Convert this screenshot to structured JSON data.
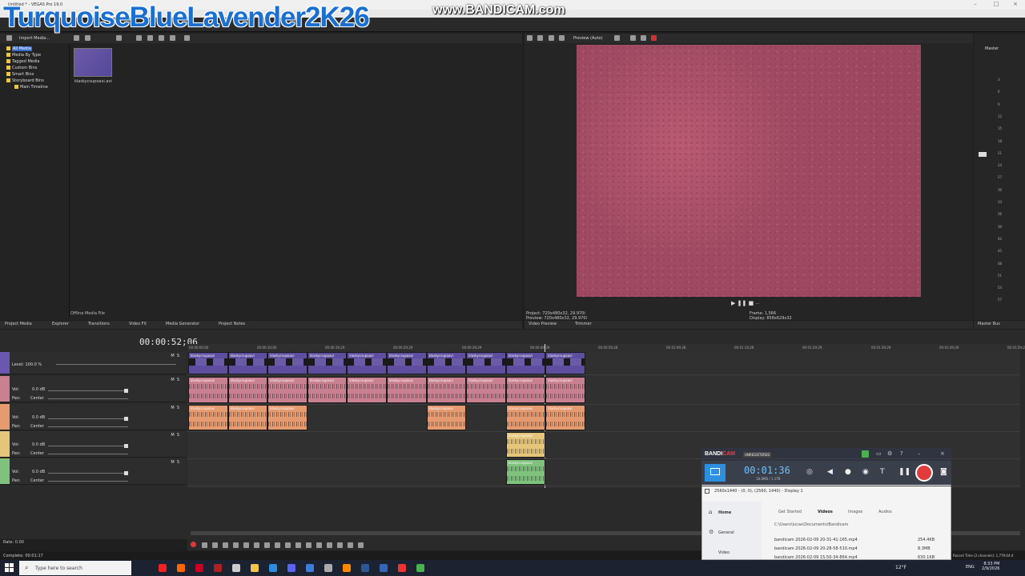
{
  "window": {
    "title": "Untitled * - VEGAS Pro 19.0",
    "overlay_title": "TurquoiseBlueLavender2K26",
    "watermark": "www.BANDICAM.com"
  },
  "media_pane": {
    "import_label": "Import Media...",
    "tree": [
      "All Media",
      "Media By Type",
      "Tagged Media",
      "Custom Bins",
      "Smart Bins",
      "Storyboard Bins",
      "Main Timeline"
    ],
    "thumbnail_label": "klaskycsupoavi.avi",
    "offline_label": "Offline Media File"
  },
  "bottom_tabs": [
    "Project Media",
    "Explorer",
    "Transitions",
    "Video FX",
    "Media Generator",
    "Project Notes"
  ],
  "preview": {
    "label": "Preview (Auto)",
    "project": "Project:  720x480x32, 29.970i",
    "preview_res": "Preview: 720x480x32, 29.970i",
    "frame": "Frame:     1,566",
    "display": "Display:    858x629x32",
    "tabs": [
      "Video Preview",
      "Trimmer"
    ]
  },
  "master": {
    "label": "Master",
    "tab": "Master Bus",
    "ticks": [
      "3",
      "6",
      "9",
      "12",
      "15",
      "18",
      "21",
      "24",
      "27",
      "30",
      "33",
      "36",
      "39",
      "42",
      "45",
      "48",
      "51",
      "54",
      "57"
    ]
  },
  "timeline": {
    "timecode": "00:00:52;06",
    "level": "Level: 100.0 %",
    "ruler": [
      "00:00:00;00",
      "00:00:10;00",
      "00:00:19;29",
      "00:00:29;29",
      "00:00:39;29",
      "00:00:49;29",
      "00:00:59;28",
      "00:01:09;28",
      "00:01:19;28",
      "00:01:29;29",
      "00:01:39;29",
      "00:01:49;29",
      "00:01:59;28"
    ],
    "clip_name": "klaskycsupoavi",
    "audio_tracks": [
      {
        "vol": "0.0 dB",
        "pan": "Center"
      },
      {
        "vol": "0.0 dB",
        "pan": "Center"
      },
      {
        "vol": "0.0 dB",
        "pan": "Center"
      },
      {
        "vol": "0.0 dB",
        "pan": "Center"
      }
    ],
    "vol_label": "Vol:",
    "pan_label": "Pan:",
    "rate": "Rate: 0.00",
    "status_left": "Complete: 00:01:17",
    "status_right": "Record Time (2 channels): 1,779:04:4"
  },
  "bandicam": {
    "logo_a": "BANDI",
    "logo_b": "CAM",
    "unregistered": "UNREGISTERED",
    "timer": "00:01:36",
    "size": "18.8MB / 1.1TB",
    "resolution": "2560x1440 - (0, 0), (2560, 1440) - Display 1",
    "sidebar": [
      "Home",
      "General",
      "Video"
    ],
    "tabs": [
      "Get Started",
      "Videos",
      "Images",
      "Audios"
    ],
    "path": "C:\\Users\\lucas\\Documents\\Bandicam",
    "files": [
      {
        "name": "bandicam 2026-02-09 20-31-41-165.mp4",
        "size": "254.4KB"
      },
      {
        "name": "bandicam 2026-02-09 20-28-58-510.mp4",
        "size": "8.3MB"
      },
      {
        "name": "bandicam 2026-02-09 15-50-34-864.mp4",
        "size": "630.1KB"
      }
    ]
  },
  "taskbar": {
    "search_placeholder": "Type here to search",
    "temp": "12°F",
    "lang": "ENG",
    "time": "8:33 PM",
    "date": "2/9/2026"
  },
  "colors": {
    "video_clip": "#5f4e9f",
    "audio_pink": "#c98091",
    "audio_orange": "#e59a70",
    "audio_yellow": "#e4c57a",
    "audio_green": "#7fc27d",
    "preview_frame": "#a04b63",
    "bandicam_accent": "#2c8fe0"
  }
}
